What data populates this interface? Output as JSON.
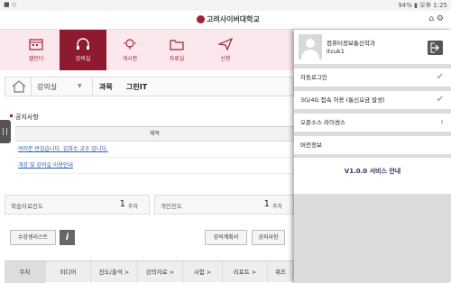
{
  "statusbar": {
    "left": "■ ◇",
    "right": "94% ▮ 오후 1:25"
  },
  "header": {
    "title": "고려사이버대학교",
    "icons": "⌂ ⚙"
  },
  "tabs": [
    {
      "label": "캘린더",
      "icon": "calendar-icon"
    },
    {
      "label": "강의실",
      "icon": "headphones-icon"
    },
    {
      "label": "게시판",
      "icon": "bulb-icon"
    },
    {
      "label": "자료실",
      "icon": "folder-icon"
    },
    {
      "label": "신청",
      "icon": "send-icon"
    }
  ],
  "crumb": {
    "select": "강의실",
    "arrow": "▼",
    "course": "과목",
    "course2": "그린IT"
  },
  "notice": {
    "title": "공지사항",
    "header": "제목",
    "rows": [
      "여러분 반갑습니다. 김희수 교수 입니다.",
      "개강 및 강의실 이용안내"
    ]
  },
  "progress": {
    "study_label": "학습자료진도",
    "study_value": "1",
    "study_unit": "주차",
    "personal_label": "개인진도",
    "personal_value": "1",
    "personal_unit": "주차"
  },
  "buttons": {
    "students": "수강생리스트",
    "info": "i",
    "plan": "강의계획서",
    "notice": "공지사항"
  },
  "bottom_tabs": [
    "주차",
    "미디어",
    "진도/출석 >",
    "강의자료 >",
    "시험 >",
    "리포트 >",
    "퀴즈"
  ],
  "drawer": {
    "name": "컴퓨터정보통신학과",
    "id": "itcuk1",
    "auto_login": "자동로그인",
    "network": "3G/4G 접속 허용 (통신요금 발생)",
    "license": "오픈소스 라이센스",
    "version_title": "버전정보",
    "version_text": "V1.0.0 서비스 안내",
    "check": "✔",
    "chevron": "›"
  },
  "colors": {
    "brand": "#8e1a2e",
    "tab_bg": "#fbe8ec",
    "link": "#2a5db0"
  }
}
